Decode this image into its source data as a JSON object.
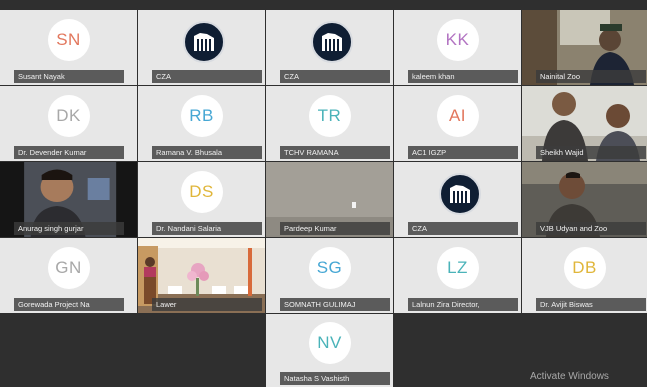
{
  "participants": [
    {
      "name": "Susant Nayak",
      "initials": "SN",
      "color": "#e2775d",
      "type": "initials"
    },
    {
      "name": "CZA",
      "type": "logo",
      "icon": "zoo-logo-icon"
    },
    {
      "name": "CZA",
      "type": "logo",
      "icon": "zoo-logo-icon"
    },
    {
      "name": "kaleem khan",
      "initials": "KK",
      "color": "#b273c2",
      "type": "initials"
    },
    {
      "name": "Nainital Zoo",
      "type": "video"
    },
    {
      "name": "Dr. Devender Kumar",
      "initials": "DK",
      "color": "#a8a8a8",
      "type": "initials"
    },
    {
      "name": "Ramana V. Bhusala",
      "initials": "RB",
      "color": "#46a7d4",
      "type": "initials"
    },
    {
      "name": "TCHV RAMANA",
      "initials": "TR",
      "color": "#4ab3b9",
      "type": "initials"
    },
    {
      "name": "AC1 IGZP",
      "initials": "AI",
      "color": "#e2775d",
      "type": "initials"
    },
    {
      "name": "Sheikh Wajid",
      "type": "video"
    },
    {
      "name": "Anurag singh gurjar",
      "type": "video"
    },
    {
      "name": "Dr. Nandani Salaria",
      "initials": "DS",
      "color": "#e0b63a",
      "type": "initials"
    },
    {
      "name": "Pardeep Kumar",
      "type": "video"
    },
    {
      "name": "CZA",
      "type": "logo",
      "icon": "zoo-logo-icon"
    },
    {
      "name": "VJB Udyan and Zoo",
      "type": "video"
    },
    {
      "name": "Gorewada Project Na",
      "initials": "GN",
      "color": "#a8a8a8",
      "type": "initials"
    },
    {
      "name": "Lawer",
      "type": "video"
    },
    {
      "name": "SOMNATH GULIMAJ",
      "initials": "SG",
      "color": "#46a7d4",
      "type": "initials"
    },
    {
      "name": "Lalnun Zira Director,",
      "initials": "LZ",
      "color": "#4ab3b9",
      "type": "initials"
    },
    {
      "name": "Dr. Avijit Biswas",
      "initials": "DB",
      "color": "#e0b63a",
      "type": "initials"
    },
    {
      "name": "Natasha S Vashisth",
      "initials": "NV",
      "color": "#4ab3b9",
      "type": "initials"
    }
  ],
  "watermark": "Activate Windows"
}
